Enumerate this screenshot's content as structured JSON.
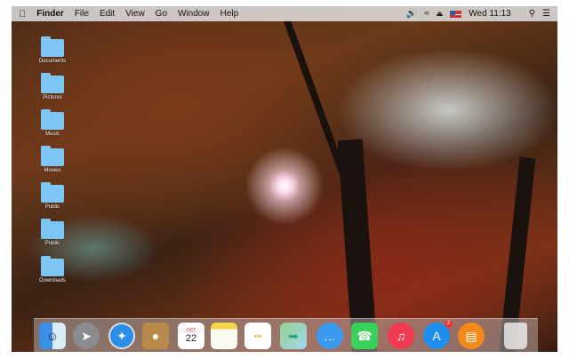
{
  "menubar": {
    "app": "Finder",
    "items": [
      "File",
      "Edit",
      "View",
      "Go",
      "Window",
      "Help"
    ],
    "clock": "Wed 11:13"
  },
  "desktop_icons": [
    "Documents",
    "Pictures",
    "Music",
    "Movies",
    "Public",
    "Public",
    "Downloads"
  ],
  "dock": {
    "apps": [
      "Finder",
      "Launchpad",
      "Safari",
      "Contacts",
      "Calendar",
      "Notes",
      "Reminders",
      "Maps",
      "Messages",
      "FaceTime",
      "iTunes",
      "App Store",
      "iBooks",
      "Trash"
    ],
    "calendar_month": "OCT",
    "calendar_day": "22",
    "appstore_badge": "2"
  }
}
